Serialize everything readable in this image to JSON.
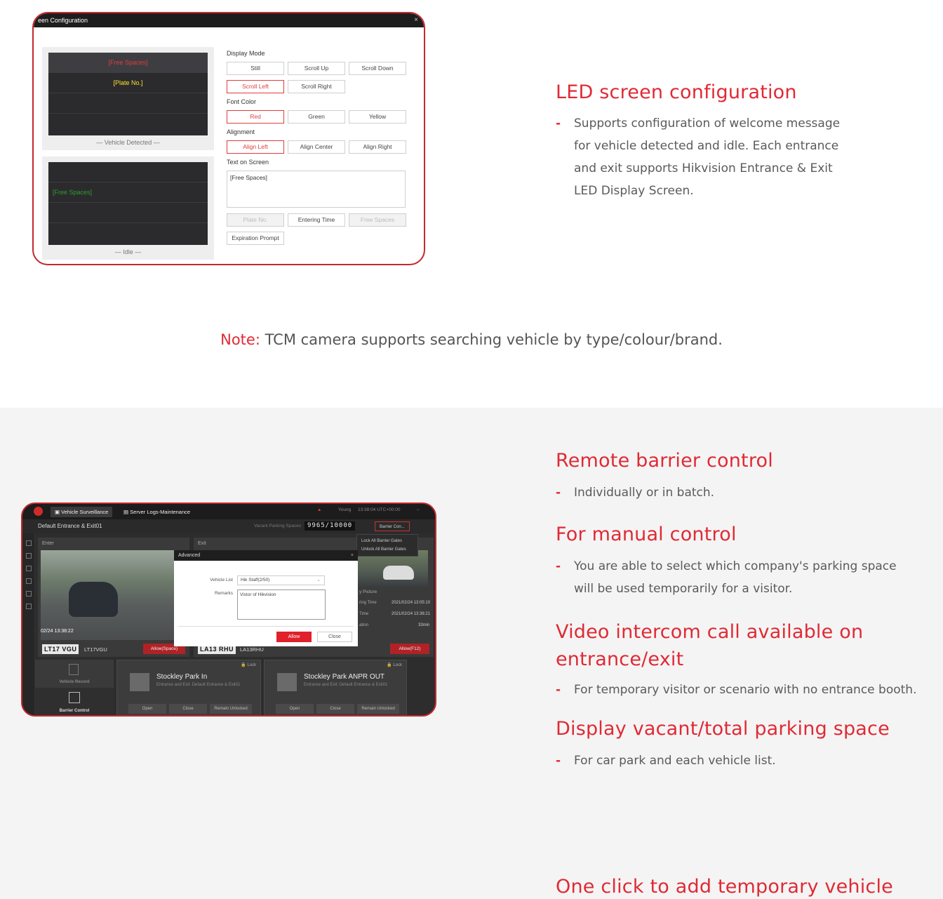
{
  "screen_config": {
    "title": "een Configuration",
    "close": "×",
    "preview_detected": {
      "line1": "[Free Spaces]",
      "line1_color": "#e03c3c",
      "line2": "[Plate No.]",
      "line2_color": "#ffe030",
      "caption": "— Vehicle Detected —"
    },
    "preview_idle": {
      "line1": "[Free Spaces]",
      "line1_color": "#2e9e2e",
      "caption": "— Idle —"
    },
    "display_mode": {
      "label": "Display Mode",
      "options": [
        "Still",
        "Scroll Up",
        "Scroll Down",
        "Scroll Left",
        "Scroll Right"
      ],
      "selected": "Scroll Left"
    },
    "font_color": {
      "label": "Font Color",
      "options": [
        "Red",
        "Green",
        "Yellow"
      ],
      "selected": "Red"
    },
    "alignment": {
      "label": "Alignment",
      "options": [
        "Align Left",
        "Align Center",
        "Align Right"
      ],
      "selected": "Align Left"
    },
    "text_on_screen": {
      "label": "Text on Screen",
      "value": "[Free Spaces]"
    },
    "insert_buttons": [
      "Plate No.",
      "Entering Time",
      "Free Spaces",
      "Expiration Prompt"
    ]
  },
  "led_section": {
    "title": "LED screen configuration",
    "dash": "-",
    "body_lines": [
      "Supports configuration of welcome message",
      "for vehicle detected and idle. Each entrance",
      "and exit supports Hikvision Entrance & Exit",
      "LED Display Screen."
    ]
  },
  "note": {
    "label": "Note:",
    "text": " TCM camera supports searching vehicle by type/colour/brand."
  },
  "features": [
    {
      "title": "Remote barrier control",
      "lines": [
        "Individually or in batch."
      ]
    },
    {
      "title": "For manual control",
      "lines": [
        "You are able to select which company's parking space",
        "will be used temporarily for a visitor."
      ]
    },
    {
      "title_lines": [
        "Video intercom call available on",
        "entrance/exit"
      ],
      "lines": [
        "For temporary visitor or scenario with no entrance booth."
      ]
    },
    {
      "title": "Display vacant/total parking space",
      "lines": [
        "For car park and each vehicle list."
      ]
    },
    {
      "title": "One click to add temporary vehicle"
    }
  ],
  "vs": {
    "tab1": "Vehicle Surveillance",
    "tab2": "Server Logs-Maintenance",
    "user": "Young",
    "clock": "13:38:04 UTC+00:00",
    "site": "Default Entrance & Exit01",
    "vacant_label": "Vacant Parking Spaces",
    "vacant_value": "9965/10000",
    "barrier_btn": "Barrier Con...",
    "dropdown": [
      "Lock All Barrier Gates",
      "Unlock All Barrier Gates"
    ],
    "enter_label": "Enter",
    "exit_label": "Exit",
    "enter_time": "02/24 13:38:22",
    "plate_enter": "LT17 VGU",
    "plate_enter_text": "LT17VGU",
    "plate_exit": "LA13 RHU",
    "plate_exit_text": "LA13RHU",
    "allow_space": "Allow(Space)",
    "allow_f12": "Allow(F12)",
    "exit_info": [
      [
        "ring Time",
        "2021/02/24 13:05:10"
      ],
      [
        "Time",
        "2021/02/24 13:38:21"
      ],
      [
        "ation",
        "33min"
      ]
    ],
    "picture_label": "y Picture",
    "dialog": {
      "title": "Advanced",
      "vehicle_list_label": "Vehicle List",
      "vehicle_list_value": "Hik Staff(2/50)",
      "remarks_label": "Remarks",
      "remarks_value": "Vistor of Hikvision",
      "allow": "Allow",
      "close": "Close"
    },
    "left_items": [
      "Vehicle Record",
      "Barrier Control"
    ],
    "cards": [
      {
        "title": "Stockley Park In",
        "sub": "Entrance and Exit: Default Entrance & Exit01",
        "lock": "Lock",
        "btns": [
          "Open",
          "Close",
          "Remain Unlocked"
        ]
      },
      {
        "title": "Stockley Park ANPR OUT",
        "sub": "Entrance and Exit: Default Entrance & Exit01",
        "lock": "Lock",
        "btns": [
          "Open",
          "Close",
          "Remain Unlocked"
        ]
      }
    ]
  }
}
